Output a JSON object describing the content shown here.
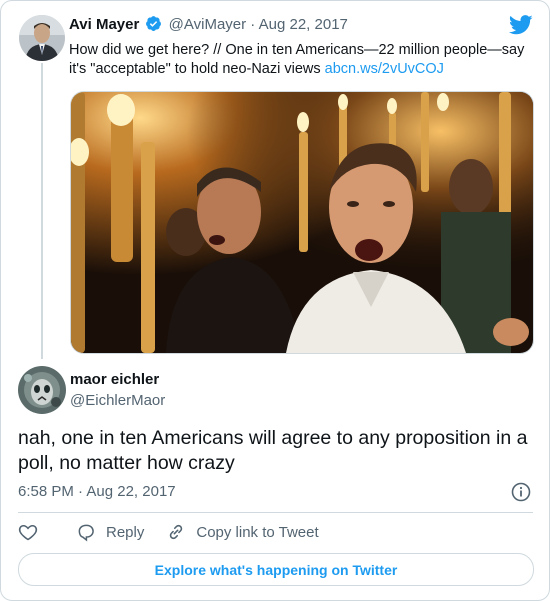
{
  "quoted_tweet": {
    "display_name": "Avi Mayer",
    "handle": "@AviMayer",
    "separator": "·",
    "date": "Aug 22, 2017",
    "text": "How did we get here? // One in ten Americans—22 million people—say it's \"acceptable\" to hold neo-Nazi views ",
    "link_text": "abcn.ws/2vUvCOJ",
    "verified": true,
    "avatar_icon": "person-photo",
    "image_alt_icon": "torch-rally-photo"
  },
  "reply": {
    "display_name": "maor eichler",
    "handle": "@EichlerMaor",
    "text": "nah, one in ten Americans will agree to any proposition in a poll, no matter how crazy",
    "time": "6:58 PM",
    "separator": "·",
    "date": "Aug 22, 2017"
  },
  "actions": {
    "like_icon": "heart-icon",
    "reply_label": "Reply",
    "copy_label": "Copy link to Tweet"
  },
  "explore_label": "Explore what's happening on Twitter",
  "colors": {
    "accent": "#1d9bf0",
    "muted": "#536471",
    "border": "#cfd9de",
    "text": "#0f1419"
  }
}
